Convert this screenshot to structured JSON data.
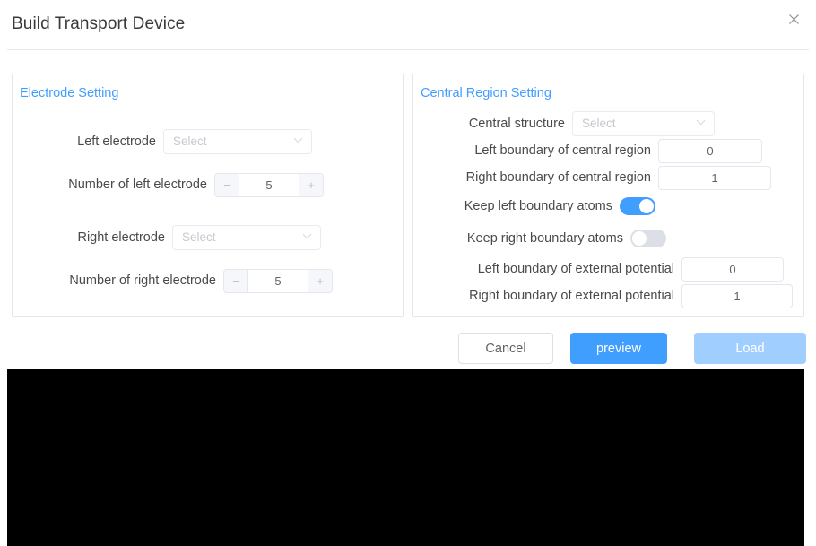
{
  "dialog": {
    "title": "Build Transport Device",
    "close_icon": "close-icon"
  },
  "electrode_panel": {
    "legend": "Electrode Setting",
    "left_electrode": {
      "label": "Left electrode",
      "placeholder": "Select",
      "value": "",
      "caret_icon": "chevron-down-icon"
    },
    "number_of_left_electrode": {
      "label": "Number of left electrode",
      "value": "5",
      "decrement": "−",
      "increment": "+"
    },
    "right_electrode": {
      "label": "Right electrode",
      "placeholder": "Select",
      "value": "",
      "caret_icon": "chevron-down-icon"
    },
    "number_of_right_electrode": {
      "label": "Number of right electrode",
      "value": "5",
      "decrement": "−",
      "increment": "+"
    }
  },
  "central_panel": {
    "legend": "Central Region Setting",
    "central_structure": {
      "label": "Central structure",
      "placeholder": "Select",
      "value": "",
      "caret_icon": "chevron-down-icon"
    },
    "left_boundary_central": {
      "label": "Left boundary of central region",
      "value": "0"
    },
    "right_boundary_central": {
      "label": "Right boundary of central region",
      "value": "1"
    },
    "keep_left_boundary_atoms": {
      "label": "Keep left boundary atoms",
      "state": "on"
    },
    "keep_right_boundary_atoms": {
      "label": "Keep right boundary atoms",
      "state": "off"
    },
    "left_boundary_potential": {
      "label": "Left boundary of external potential",
      "value": "0"
    },
    "right_boundary_potential": {
      "label": "Right boundary of external potential",
      "value": "1"
    }
  },
  "footer": {
    "cancel_label": "Cancel",
    "preview_label": "preview",
    "load_label": "Load"
  },
  "colors": {
    "accent": "#409EFF",
    "accent_disabled": "#a0cfff",
    "border": "#e4e7ed",
    "viewport_background": "#000000"
  }
}
